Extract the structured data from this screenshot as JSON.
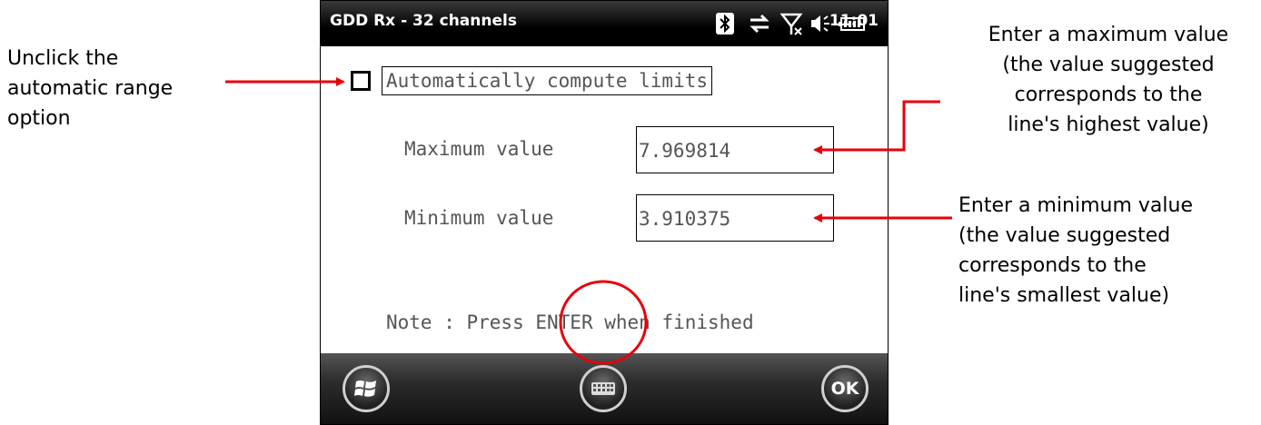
{
  "annotations": {
    "left": "Unclick the\nautomatic range\noption",
    "max": "Enter a maximum value\n(the value suggested\ncorresponds to the\nline's highest value)",
    "min": "Enter a minimum value\n(the value suggested\ncorresponds to the\nline's smallest value)"
  },
  "statusbar": {
    "title": "GDD Rx - 32 channels",
    "time": "11:01",
    "icons": [
      "bluetooth-icon",
      "data-sync-icon",
      "no-signal-icon",
      "volume-icon",
      "battery-icon"
    ]
  },
  "form": {
    "auto_label": "Automatically compute limits",
    "auto_checked": false,
    "max_label": "Maximum value",
    "max_value": "7.969814",
    "min_label": "Minimum value",
    "min_value": "3.910375",
    "note_prefix": "Note : Press ",
    "note_key": "ENTER",
    "note_suffix": " when finished"
  },
  "bottombar": {
    "ok_label": "OK"
  },
  "colors": {
    "annotation": "#e8000b",
    "status_bg": "#000000",
    "field_text": "#555555"
  }
}
